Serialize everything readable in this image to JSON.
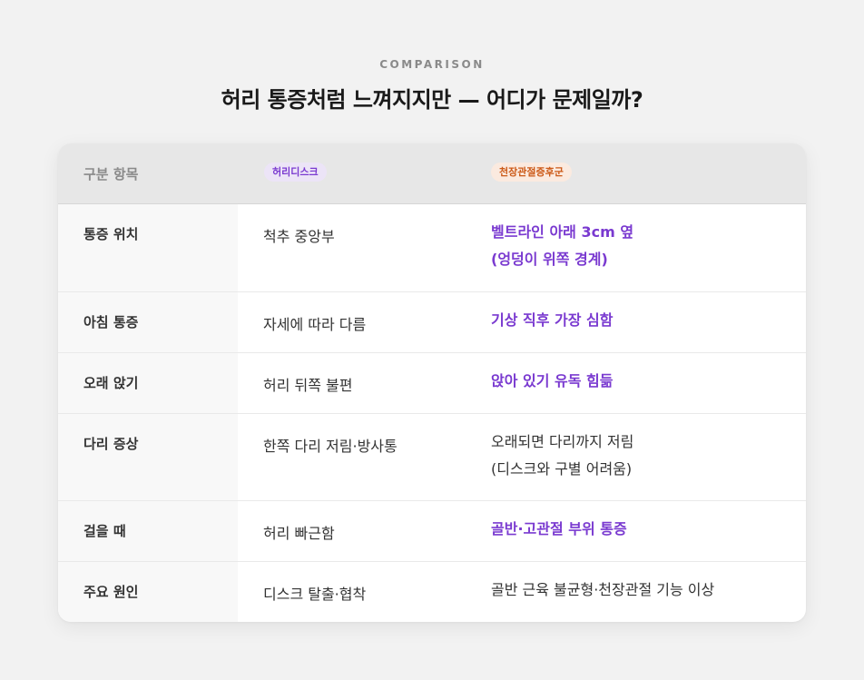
{
  "header": {
    "eyebrow": "COMPARISON",
    "title": "허리 통증처럼 느껴지지만 — 어디가 문제일까?"
  },
  "table": {
    "columns": {
      "category": "구분 항목",
      "disc": "허리디스크",
      "sij": "천장관절증후군"
    },
    "rows": [
      {
        "label": "통증 위치",
        "disc": "척추 중앙부",
        "sij_lines": [
          "벨트라인 아래 3cm 옆",
          "(엉덩이 위쪽 경계)"
        ],
        "sij_highlight": true
      },
      {
        "label": "아침 통증",
        "disc": "자세에 따라 다름",
        "sij_lines": [
          "기상 직후 가장 심함"
        ],
        "sij_highlight": true
      },
      {
        "label": "오래 앉기",
        "disc": "허리 뒤쪽 불편",
        "sij_lines": [
          "앉아 있기 유독 힘듦"
        ],
        "sij_highlight": true
      },
      {
        "label": "다리 증상",
        "disc": "한쪽 다리 저림·방사통",
        "sij_lines": [
          "오래되면 다리까지 저림",
          "(디스크와 구별 어려움)"
        ],
        "sij_highlight": false
      },
      {
        "label": "걸을 때",
        "disc": "허리 빠근함",
        "sij_lines": [
          "골반·고관절 부위 통증"
        ],
        "sij_highlight": true
      },
      {
        "label": "주요 원인",
        "disc": "디스크 탈출·협착",
        "sij_lines": [
          "골반 근육 불균형·천장관절 기능 이상"
        ],
        "sij_highlight": false
      }
    ]
  },
  "colors": {
    "accent_purple": "#7a3ad0",
    "accent_orange": "#cc5a18"
  }
}
